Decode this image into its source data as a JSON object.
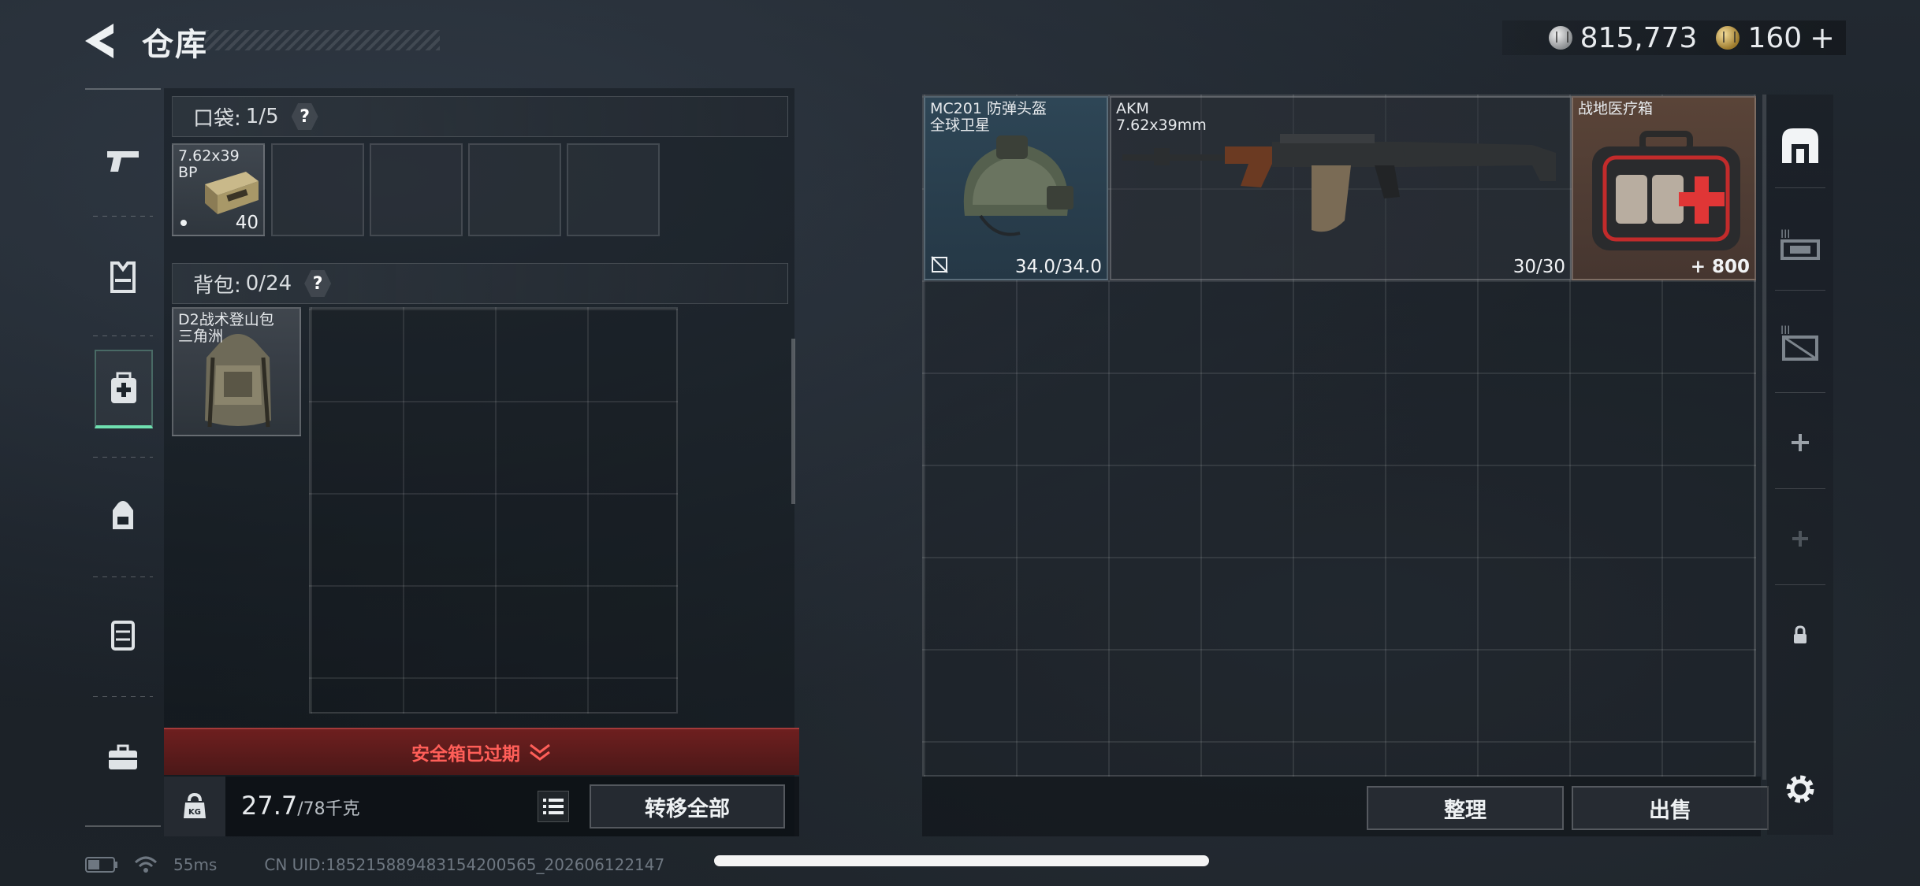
{
  "header": {
    "title": "仓库",
    "currencies": [
      {
        "icon": "silver-coin-icon",
        "value": "815,773"
      },
      {
        "icon": "gold-coin-icon",
        "value": "160",
        "add": "+"
      }
    ]
  },
  "left_rail": {
    "items": [
      {
        "icon": "pistol-icon"
      },
      {
        "icon": "vest-icon"
      },
      {
        "icon": "medkit-bag-icon",
        "active": true
      },
      {
        "icon": "backpack-icon"
      },
      {
        "icon": "chest-rig-icon"
      },
      {
        "icon": "briefcase-icon"
      }
    ]
  },
  "pocket": {
    "label": "口袋:",
    "capacity": "1/5",
    "help": "?",
    "items": [
      {
        "name": "7.62x39\nBP",
        "count": "40"
      }
    ],
    "empty_slots": 4
  },
  "backpack": {
    "label": "背包:",
    "capacity": "0/24",
    "help": "?",
    "equipped": {
      "name": "D2战术登山包\n三角洲"
    }
  },
  "safebox": {
    "status": "安全箱已过期"
  },
  "weight": {
    "value": "27.7",
    "max": "/78千克"
  },
  "transfer_all_label": "转移全部",
  "stash": {
    "items": [
      {
        "name": "MC201 防弹头盔\n全球卫星",
        "durability": "34.0/34.0"
      },
      {
        "name": "AKM\n7.62x39mm",
        "ammo": "30/30"
      },
      {
        "name": "战地医疗箱",
        "heal": "800",
        "heal_prefix": "+"
      }
    ],
    "buttons": {
      "sort": "整理",
      "sell": "出售"
    }
  },
  "right_rail": {
    "items": [
      {
        "icon": "stash-tab-icon"
      },
      {
        "icon": "stash-tab-3-icon"
      },
      {
        "icon": "stash-tab-3b-icon"
      },
      {
        "icon": "add-tab-icon"
      },
      {
        "icon": "add-tab-disabled-icon"
      },
      {
        "icon": "lock-icon"
      }
    ]
  },
  "status": {
    "ping": "55ms",
    "uid": "CN UID:185215889483154200565_202606122147"
  },
  "colors": {
    "accent": "#6fe0b0",
    "alert": "#ff5e58"
  }
}
